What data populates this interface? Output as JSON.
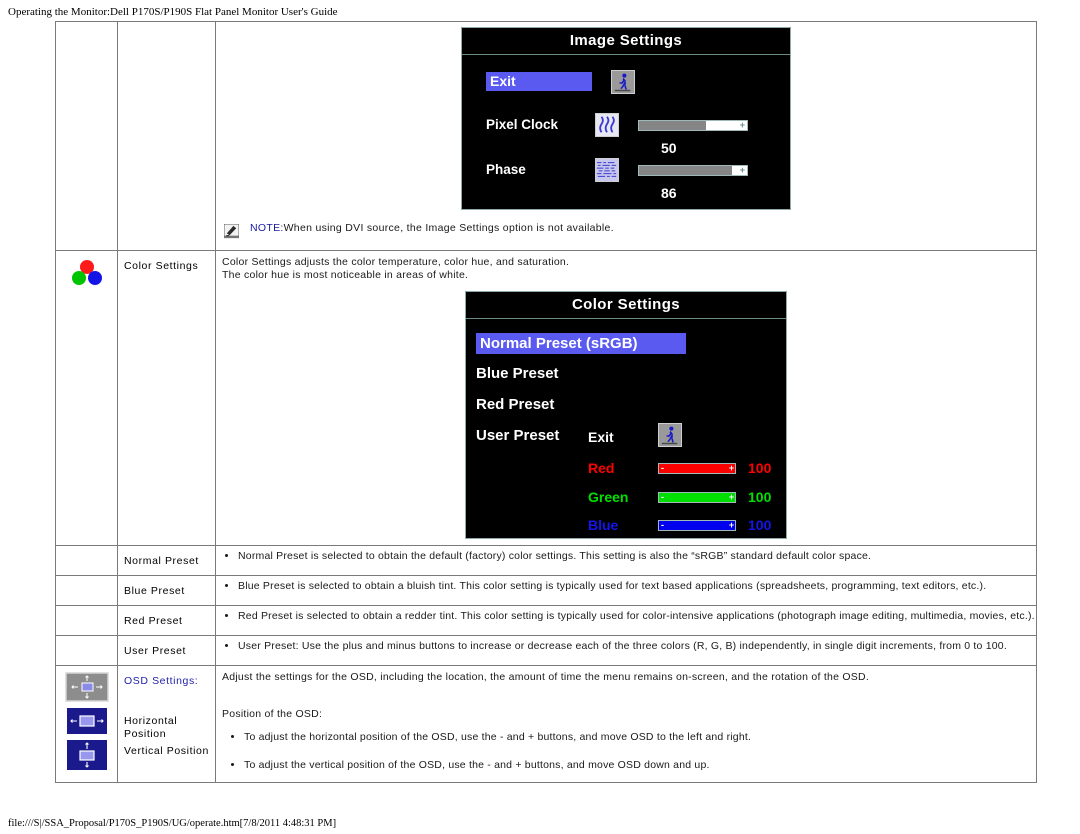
{
  "page": {
    "header": "Operating the Monitor:Dell P170S/P190S Flat Panel Monitor User's Guide",
    "footer": "file:///S|/SSA_Proposal/P170S_P190S/UG/operate.htm[7/8/2011 4:48:31 PM]"
  },
  "image_settings": {
    "osd_title": "Image Settings",
    "exit_label": "Exit",
    "items": [
      {
        "label": "Pixel Clock",
        "value": "50",
        "percent": 62,
        "minus": "-",
        "plus": "+"
      },
      {
        "label": "Phase",
        "value": "86",
        "percent": 86,
        "minus": "-",
        "plus": "+"
      }
    ],
    "note_keyword": "NOTE:",
    "note_text": "When using  DVI source, the Image Settings option is not available."
  },
  "color_settings": {
    "row_name": "Color Settings",
    "description_line1": "Color Settings adjusts the color temperature, color hue, and saturation.",
    "description_line2": "The color hue is most noticeable in areas of white.",
    "osd_title": "Color Settings",
    "presets": [
      {
        "label": "Normal Preset (sRGB)",
        "selected": true
      },
      {
        "label": "Blue Preset",
        "selected": false
      },
      {
        "label": "Red Preset",
        "selected": false
      },
      {
        "label": "User Preset",
        "selected": false
      }
    ],
    "user_panel": {
      "exit_label": "Exit",
      "channels": [
        {
          "label": "Red",
          "value": "100",
          "color": "#ff0000",
          "percent": 100
        },
        {
          "label": "Green",
          "value": "100",
          "color": "#00e000",
          "percent": 100
        },
        {
          "label": "Blue",
          "value": "100",
          "color": "#0000ee",
          "percent": 100
        }
      ]
    },
    "preset_rows": [
      {
        "name": "Normal Preset",
        "text": "Normal Preset is selected to obtain the default (factory) color settings. This setting is also the “sRGB” standard default color space."
      },
      {
        "name": "Blue Preset",
        "text": "Blue Preset is selected to obtain a bluish tint. This color setting is typically used for text based applications (spreadsheets, programming, text editors, etc.)."
      },
      {
        "name": "Red Preset",
        "text": "Red Preset is selected to obtain a redder tint. This color setting is typically used for color-intensive applications (photograph image editing, multimedia, movies, etc.)."
      },
      {
        "name": "User Preset",
        "text": "User Preset: Use the plus and minus buttons to increase or decrease each of the three colors (R, G, B) independently, in single digit increments, from 0 to 100."
      }
    ]
  },
  "osd_settings": {
    "row_name": "OSD Settings:",
    "description": "Adjust the settings for the OSD, including the location, the amount of time the menu remains on-screen, and the rotation of the OSD.",
    "sub_names": [
      "Horizontal Position",
      "Vertical Position"
    ],
    "position_heading": "Position of the OSD:",
    "bullets": [
      "To adjust the horizontal position of the OSD, use the - and +  buttons, and move OSD to the left and right.",
      "To adjust the vertical position of the OSD, use the - and +  buttons, and move OSD down and up."
    ]
  },
  "colors": {
    "osd_highlight": "#5a5af0",
    "osd_background": "#000000",
    "osd_border": "#8fa8a8",
    "link_blue": "#2222aa",
    "red": "#ff0000",
    "green": "#00cc00",
    "blue": "#0000ee"
  },
  "icons": {
    "color_wheel": "color-circles-icon",
    "osd_position": "osd-position-icon",
    "horizontal_position": "horizontal-position-icon",
    "vertical_position": "vertical-position-icon",
    "exit": "running-man-exit-icon",
    "pixel_clock": "pixel-clock-icon",
    "phase": "phase-icon",
    "note": "note-pencil-icon"
  }
}
